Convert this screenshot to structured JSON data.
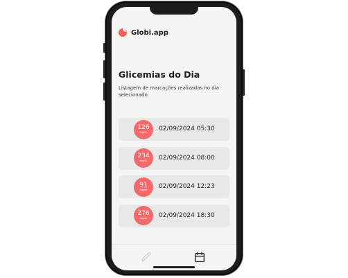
{
  "app": {
    "name": "Globi.app",
    "icon": "blood-drop-icon",
    "brand_color": "#f25d5d"
  },
  "page": {
    "title": "Glicemias do Dia",
    "subtitle": "Listagem de marcações realizadas no dia selecionado."
  },
  "records": [
    {
      "value": "126",
      "unit": "mg/dL",
      "datetime": "02/09/2024 05:30"
    },
    {
      "value": "234",
      "unit": "mg/dL",
      "datetime": "02/09/2024 08:00"
    },
    {
      "value": "91",
      "unit": "mg/dL",
      "datetime": "02/09/2024 12:23"
    },
    {
      "value": "276",
      "unit": "mg/dL",
      "datetime": "02/09/2024 18:30"
    }
  ],
  "bottom_nav": {
    "items": [
      {
        "icon": "pencil-icon",
        "active": false
      },
      {
        "icon": "calendar-icon",
        "active": true
      }
    ],
    "active_color": "#1e1e1e",
    "inactive_color": "#cfcfcf"
  }
}
